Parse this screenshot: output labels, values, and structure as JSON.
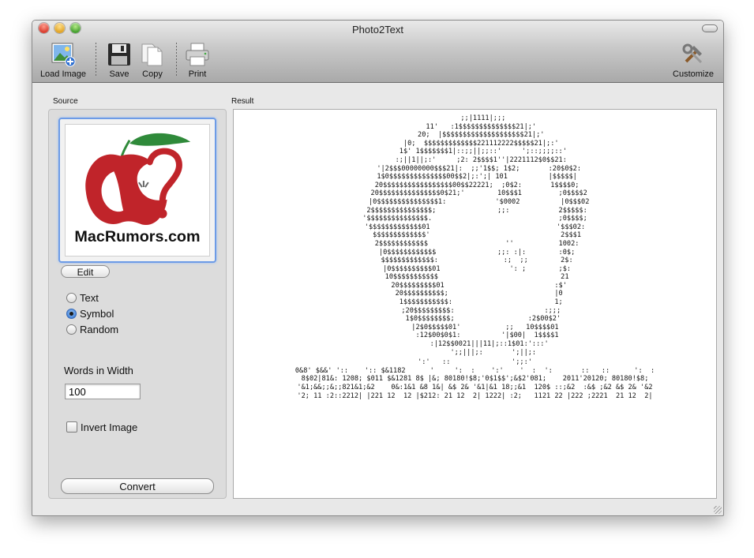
{
  "window": {
    "title": "Photo2Text"
  },
  "toolbar": {
    "load_image": "Load Image",
    "save": "Save",
    "copy": "Copy",
    "print": "Print",
    "customize": "Customize"
  },
  "sidebar": {
    "source_label": "Source",
    "image": {
      "logo_text": "MacRumors.com",
      "logo_color_apple": "#c0242a",
      "logo_color_leaf": "#2f8a3a"
    },
    "edit_label": "Edit",
    "modes": [
      {
        "label": "Text",
        "selected": false
      },
      {
        "label": "Symbol",
        "selected": true
      },
      {
        "label": "Random",
        "selected": false
      }
    ],
    "words_label": "Words in Width",
    "words_value": "100",
    "invert_label": "Invert Image",
    "invert_checked": false,
    "convert_label": "Convert"
  },
  "result": {
    "label": "Result",
    "lines": [
      "    ;;|1111|;;;",
      "   11'   :1$$$$$$$$$$$$$$21|;'",
      "   20;  |$$$$$$$$$$$$$$$$$$$$21|;'",
      "   |0;  $$$$$$$$$$$$$221112222$$$$$21|;:'",
      "    1$' 1$$$$$$$1|::;;||;;::'     ';::;;;;::'",
      "   :;||1||;:'     ;2: 2$$$$1''|2221112$0$$21:",
      "  '|2$$$00000000$$$21|:  ;;'1$$; 1$2;       :20$0$2:",
      " 1$0$$$$$$$$$$$$$$00$$2|;:';| 101          |$$$$$|",
      " 20$$$$$$$$$$$$$$$$$00$$22221;  ;0$2:       1$$$$0;",
      "  20$$$$$$$$$$$$$$$0$21;'        10$$$1         ;0$$$$2",
      "  |0$$$$$$$$$$$$$$$1:            '$0002          |0$$$02",
      " 2$$$$$$$$$$$$$$$;               ;;:            2$$$$$:",
      "'$$$$$$$$$$$$$$$.                               ;0$$$$;",
      "'$$$$$$$$$$$$$01                               '$$$02:",
      " $$$$$$$$$$$$$'                                2$$$1",
      " 2$$$$$$$$$$$$                   ''           1002:",
      " |0$$$$$$$$$$$$               ;;: :|:        :0$;",
      " $$$$$$$$$$$$$:                :;  ;;        2$:",
      " |0$$$$$$$$$$01                 ': ;        ;$:",
      " 10$$$$$$$$$$$                              21",
      "  20$$$$$$$$$01                           :$'",
      "  20$$$$$$$$$$;                          |0",
      "   1$$$$$$$$$$$:                         1;",
      "   ;20$$$$$$$$$:                      :;;;",
      "    1$0$$$$$$$$;                  :2$00$2'",
      "     |2$0$$$$$01'           ;;   10$$$$01",
      "      :12$00$0$1:          '|$00|  1$$$$1",
      "       :|12$$0021|||11|;::1$01:':::'",
      "         ';;|||;:       ';||;:",
      "':'   ::               ';;:'",
      "0&8' $&&' '::    ':: $&1182      '     ':  :    ':'    '  :  ':       ::   ::      ':  :",
      "8$02|81&: 1208; $011 $&1281 8$ |&; 80180!$8;'0$1$$';&$2'081;    2011'20120; 80180!$8;",
      "'&1;&&;;&;;821&1;&2    0&:1&1 &8 1&| &$ 2& '&1|&1 18;;&1  120$ ::;&2  :&$ ;&2 &$ 2& '&2",
      "'2; 11 :2::2212| |221 12  12 |$212: 21 12  2| 1222| :2;   1121 22 |222 ;2221  21 12  2|"
    ]
  }
}
